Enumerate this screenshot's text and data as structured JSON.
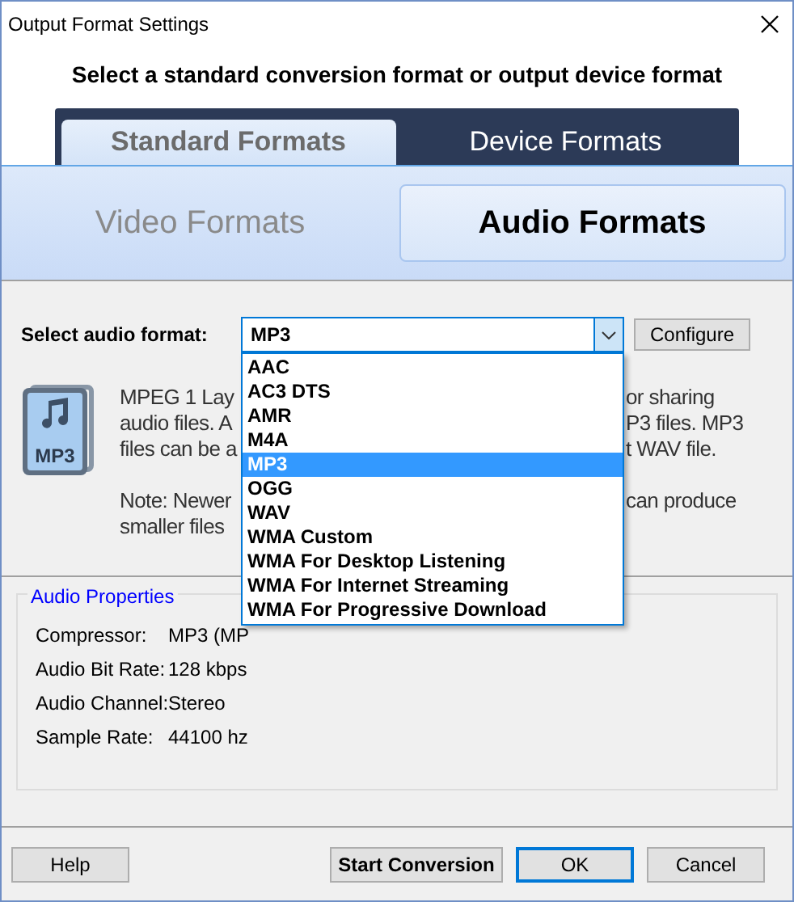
{
  "window": {
    "title": "Output Format Settings"
  },
  "header": "Select a standard conversion format or output device format",
  "tabs": [
    {
      "label": "Standard Formats",
      "selected": true
    },
    {
      "label": "Device Formats",
      "selected": false
    }
  ],
  "format_tabs": [
    {
      "label": "Video Formats",
      "selected": false
    },
    {
      "label": "Audio Formats",
      "selected": true
    }
  ],
  "audio_format": {
    "label": "Select audio format:",
    "value": "MP3",
    "expanded": true,
    "options": [
      {
        "label": "AAC",
        "selected": false
      },
      {
        "label": "AC3 DTS",
        "selected": false
      },
      {
        "label": "AMR",
        "selected": false
      },
      {
        "label": "M4A",
        "selected": false
      },
      {
        "label": "MP3",
        "selected": true
      },
      {
        "label": "OGG",
        "selected": false
      },
      {
        "label": "WAV",
        "selected": false
      },
      {
        "label": "WMA Custom",
        "selected": false
      },
      {
        "label": "WMA For Desktop Listening",
        "selected": false
      },
      {
        "label": "WMA For Internet Streaming",
        "selected": false
      },
      {
        "label": "WMA For Progressive Download",
        "selected": false
      }
    ]
  },
  "configure_button": "Configure",
  "icon_label": "MP3",
  "description": [
    [
      {
        "left": "MPEG 1 Lay",
        "right": "or sharing"
      },
      {
        "left": "audio files. A",
        "right": "P3 files.  MP3"
      },
      {
        "left": "files can be a",
        "right": "t WAV file."
      }
    ],
    [
      {
        "left": "Note: Newer",
        "right": "can produce"
      },
      {
        "left": "smaller files"
      }
    ]
  ],
  "properties": {
    "title": "Audio Properties",
    "rows": [
      {
        "label": "Compressor:",
        "value": "MP3 (MP"
      },
      {
        "label": "Audio Bit Rate:",
        "value": "128 kbps"
      },
      {
        "label": "Audio Channel:",
        "value": "Stereo"
      },
      {
        "label": "Sample Rate:",
        "value": "44100 hz"
      }
    ]
  },
  "buttons_left": [
    {
      "label": "Help"
    }
  ],
  "buttons_right": [
    {
      "label": "Start Conversion",
      "kind": "bold"
    },
    {
      "label": "OK",
      "kind": "default"
    },
    {
      "label": "Cancel",
      "kind": "normal"
    }
  ]
}
